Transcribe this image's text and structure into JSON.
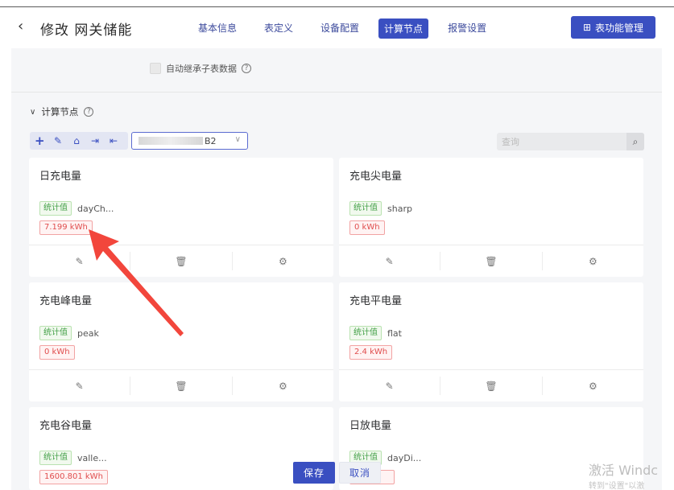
{
  "header": {
    "back_icon": "‹",
    "title": "修改 网关储能",
    "tabs": [
      "基本信息",
      "表定义",
      "设备配置",
      "计算节点",
      "报警设置"
    ],
    "active_tab": "计算节点",
    "func_button": "表功能管理"
  },
  "settings": {
    "inherit_label": "自动继承子表数据"
  },
  "section": {
    "title": "计算节点",
    "select_visible_suffix": "B2",
    "search_placeholder": "查询"
  },
  "cards": [
    {
      "name": "日充电量",
      "tag": "统计值",
      "code": "dayCh...",
      "value": "7.199 kWh"
    },
    {
      "name": "充电尖电量",
      "tag": "统计值",
      "code": "sharp",
      "value": "0 kWh"
    },
    {
      "name": "充电峰电量",
      "tag": "统计值",
      "code": "peak",
      "value": "0 kWh"
    },
    {
      "name": "充电平电量",
      "tag": "统计值",
      "code": "flat",
      "value": "2.4 kWh"
    },
    {
      "name": "充电谷电量",
      "tag": "统计值",
      "code": "valle...",
      "value": "1600.801 kWh"
    },
    {
      "name": "日放电量",
      "tag": "统计值",
      "code": "dayDi...",
      "value": ""
    }
  ],
  "footer": {
    "save": "保存",
    "cancel": "取消"
  },
  "watermark": {
    "line1": "激活 Windc",
    "line2": "转到\"设置\"以激"
  },
  "colors": {
    "primary": "#3a4fc1",
    "success": "#43a047",
    "danger": "#e04d4d",
    "arrow": "#f2463c"
  }
}
